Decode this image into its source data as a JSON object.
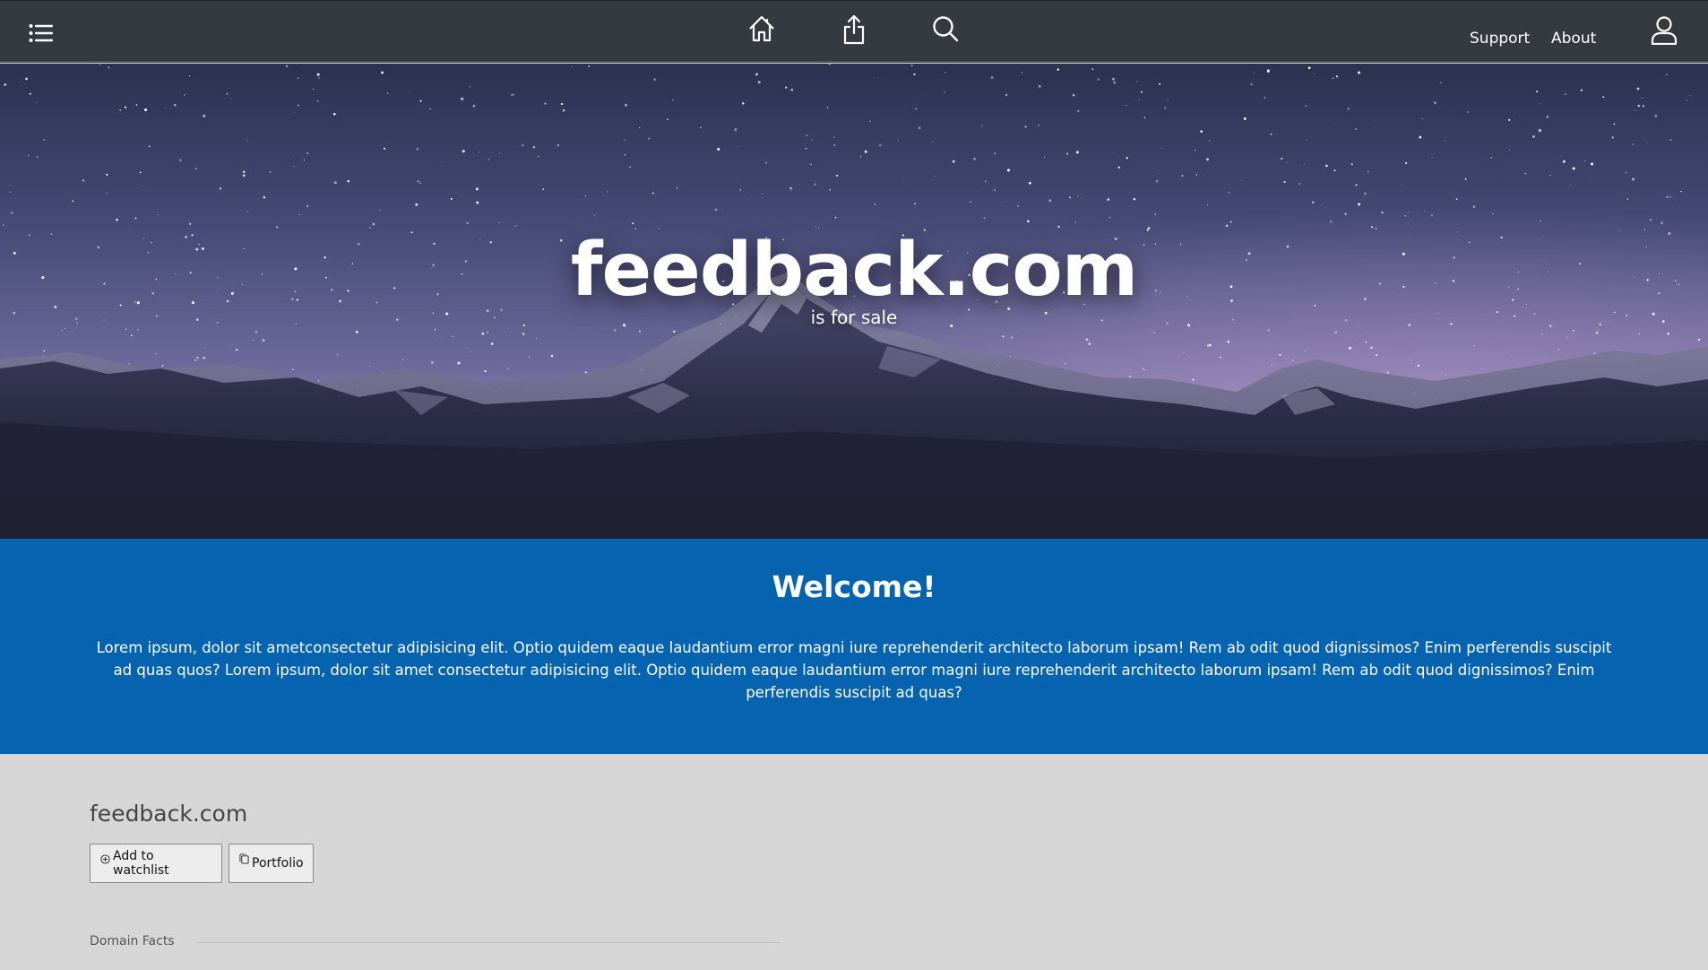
{
  "navbar": {
    "menu_icon": "list-icon",
    "home_icon": "home-icon",
    "share_icon": "share-icon",
    "search_icon": "search-icon",
    "support_label": "Support",
    "about_label": "About",
    "user_icon": "user-icon",
    "background": "#343a40"
  },
  "hero": {
    "title": "feedback.com",
    "subtitle": "is for sale"
  },
  "welcome": {
    "title": "Welcome!",
    "text": "Lorem ipsum, dolor sit ametconsectetur adipisicing elit. Optio quidem eaque laudantium error magni iure reprehenderit architecto laborum ipsam! Rem ab odit quod dignissimos? Enim perferendis suscipit ad quas quos? Lorem ipsum, dolor sit amet consectetur adipisicing elit. Optio quidem eaque laudantium error magni iure reprehenderit architecto laborum ipsam! Rem ab odit quod dignissimos? Enim perferendis suscipit ad quas?",
    "background": "#0563b0"
  },
  "content": {
    "domain_name": "feedback.com",
    "watchlist_label": "Add to watchlist",
    "watchlist_icon": "plus-circle-icon",
    "portfolio_label": "Portfolio",
    "portfolio_icon": "copy-icon",
    "facts_label": "Domain Facts",
    "background": "#d6d6d6"
  }
}
